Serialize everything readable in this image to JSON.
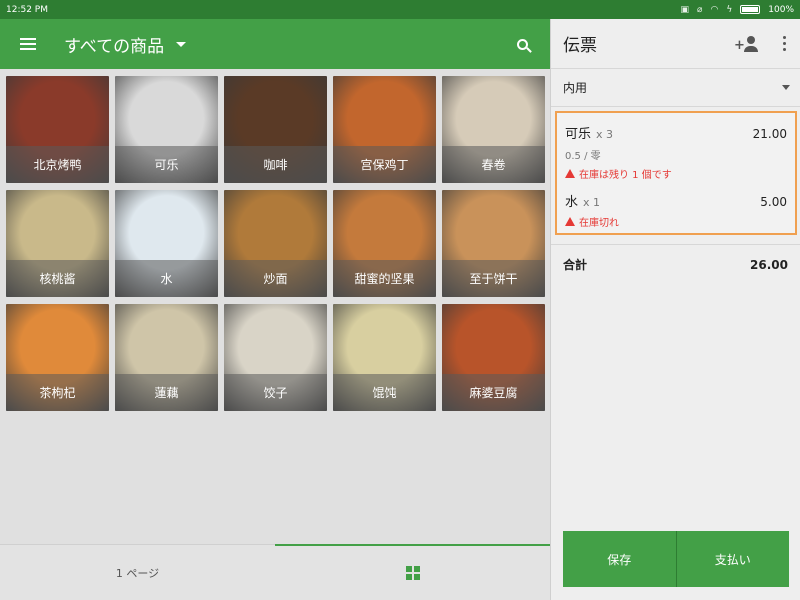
{
  "status_bar": {
    "time": "12:52 PM",
    "battery": "100%",
    "battery_level": 1.0
  },
  "app_bar": {
    "title": "すべての商品"
  },
  "products": [
    {
      "name": "北京烤鸭",
      "color": "#8a3a2a"
    },
    {
      "name": "可乐",
      "color": "#d9d9d9"
    },
    {
      "name": "咖啡",
      "color": "#5a3a26"
    },
    {
      "name": "宫保鸡丁",
      "color": "#c2662d"
    },
    {
      "name": "春卷",
      "color": "#d6cbb8"
    },
    {
      "name": "核桃酱",
      "color": "#c9b98a"
    },
    {
      "name": "水",
      "color": "#dfe8ee"
    },
    {
      "name": "炒面",
      "color": "#b07a3a"
    },
    {
      "name": "甜蜜的坚果",
      "color": "#c47a3c"
    },
    {
      "name": "至于饼干",
      "color": "#c9925a"
    },
    {
      "name": "茶枸杞",
      "color": "#e08a3a"
    },
    {
      "name": "蓮藕",
      "color": "#cfc5a8"
    },
    {
      "name": "饺子",
      "color": "#d9d4c7"
    },
    {
      "name": "馄饨",
      "color": "#d8cfa0"
    },
    {
      "name": "麻婆豆腐",
      "color": "#b8542a"
    }
  ],
  "bottom_bar": {
    "page_label": "1 ページ"
  },
  "order_panel": {
    "title": "伝票",
    "dine_option": "内用",
    "items": [
      {
        "name": "可乐",
        "qty": "x 3",
        "price": "21.00",
        "detail": "0.5 / 零",
        "warning": "在庫は残り 1 個です"
      },
      {
        "name": "水",
        "qty": "x 1",
        "price": "5.00",
        "detail": "",
        "warning": "在庫切れ"
      }
    ],
    "total_label": "合計",
    "total_value": "26.00",
    "save_label": "保存",
    "pay_label": "支払い"
  },
  "colors": {
    "primary": "#43a047",
    "primary_dark": "#2e7d32",
    "warning": "#e53935",
    "highlight": "#f0a050"
  }
}
